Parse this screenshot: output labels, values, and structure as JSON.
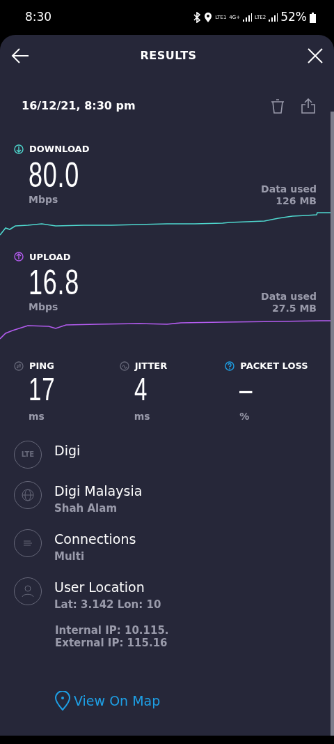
{
  "status_bar": {
    "time": "8:30",
    "sim1": "LTE1",
    "network": "4G+",
    "sim2": "LTE2",
    "battery": "52%"
  },
  "header": {
    "title": "RESULTS"
  },
  "result": {
    "date": "16/12/21, 8:30 pm"
  },
  "speeds": [
    {
      "kind": "download",
      "label": "DOWNLOAD",
      "value": "80.0",
      "unit": "Mbps",
      "data_label": "Data used",
      "data_value": "126 MB",
      "color": "#4fd8cf"
    },
    {
      "kind": "upload",
      "label": "UPLOAD",
      "value": "16.8",
      "unit": "Mbps",
      "data_label": "Data used",
      "data_value": "27.5 MB",
      "color": "#b45cf0"
    }
  ],
  "metrics": [
    {
      "kind": "ping",
      "label": "PING",
      "value": "17",
      "unit": "ms"
    },
    {
      "kind": "jitter",
      "label": "JITTER",
      "value": "4",
      "unit": "ms"
    },
    {
      "kind": "packet_loss",
      "label": "PACKET LOSS",
      "value": "–",
      "unit": "%"
    }
  ],
  "info": [
    {
      "kind": "lte",
      "icon_text": "LTE",
      "title": "Digi"
    },
    {
      "kind": "globe",
      "title": "Digi Malaysia",
      "subtitle": "Shah Alam"
    },
    {
      "kind": "connections",
      "title": "Connections",
      "subtitle": "Multi"
    },
    {
      "kind": "user",
      "title": "User Location",
      "subtitle": "Lat: 3.142 Lon: 10"
    }
  ],
  "ip_lines": [
    "Internal IP: 10.115.",
    "External IP: 115.16"
  ],
  "map_link": "View On Map"
}
